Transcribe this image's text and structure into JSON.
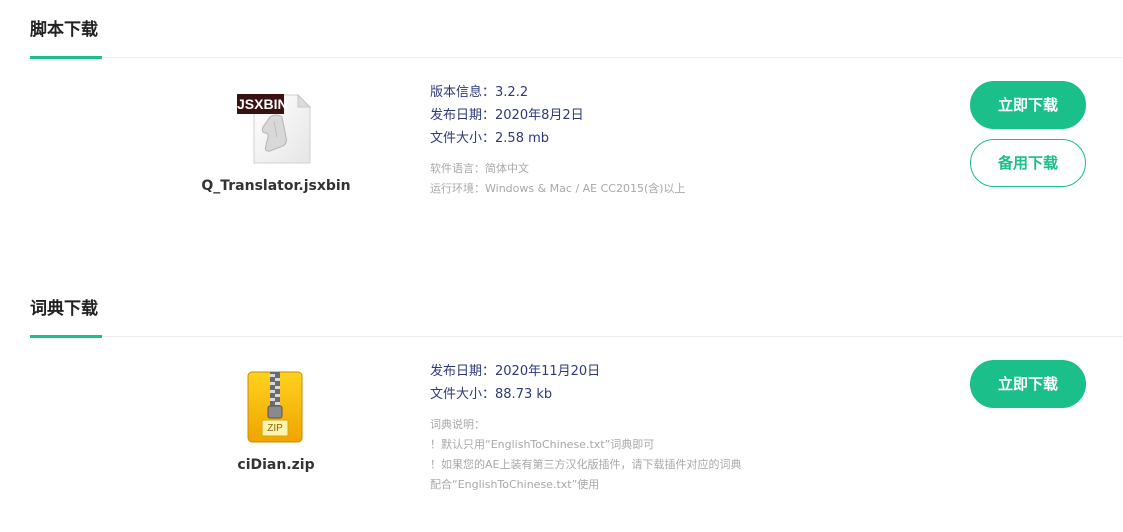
{
  "script_section": {
    "title": "脚本下载",
    "icon_badge": "JSXBIN",
    "file_name": "Q_Translator.jsxbin",
    "version_label": "版本信息：",
    "version_value": "3.2.2",
    "date_label": "发布日期：",
    "date_value": "2020年8月2日",
    "size_label": "文件大小：",
    "size_value": "2.58 mb",
    "language_label": "软件语言：",
    "language_value": "简体中文",
    "env_label": "运行环境：",
    "env_value": "Windows & Mac / AE CC2015(含)以上",
    "download_button": "立即下载",
    "backup_button": "备用下载"
  },
  "dict_section": {
    "title": "词典下载",
    "icon_badge": "ZIP",
    "file_name": "ciDian.zip",
    "date_label": "发布日期：",
    "date_value": "2020年11月20日",
    "size_label": "文件大小：",
    "size_value": "88.73 kb",
    "notes": [
      "词典说明：",
      "！默认只用“EnglishToChinese.txt”词典即可",
      "！如果您的AE上装有第三方汉化版插件，请下载插件对应的词典",
      "配合“EnglishToChinese.txt”使用"
    ],
    "download_button": "立即下载"
  },
  "colors": {
    "accent": "#1bbf8a",
    "label": "#2d3a7a",
    "muted": "#a8a8a8"
  }
}
